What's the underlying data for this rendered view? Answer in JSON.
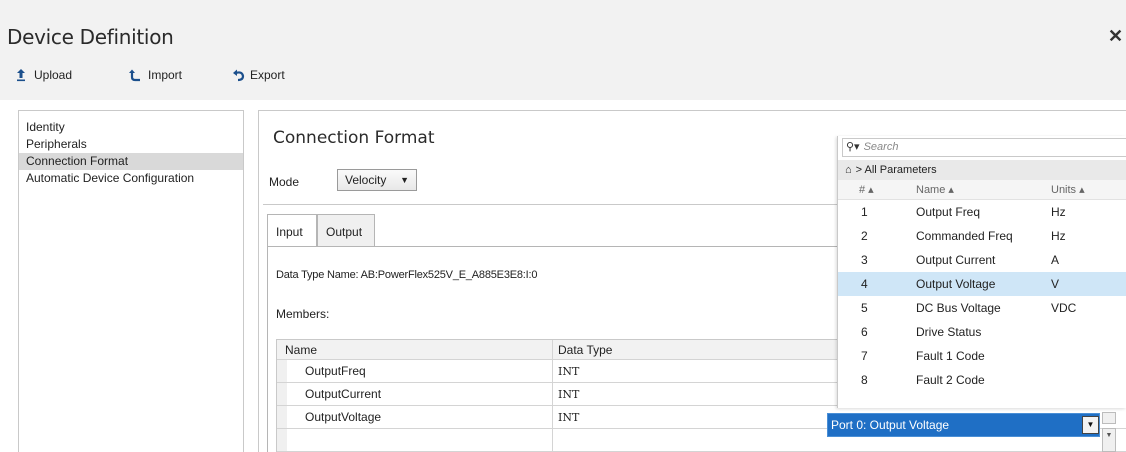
{
  "window": {
    "title": "Device Definition",
    "close_icon": "close-icon"
  },
  "toolbar": {
    "upload_label": "Upload",
    "import_label": "Import",
    "export_label": "Export"
  },
  "nav": {
    "items": [
      {
        "label": "Identity"
      },
      {
        "label": "Peripherals"
      },
      {
        "label": "Connection Format"
      },
      {
        "label": "Automatic Device Configuration"
      }
    ],
    "selected": "Connection Format"
  },
  "main": {
    "section_title": "Connection Format",
    "mode_label": "Mode",
    "mode_value": "Velocity",
    "tabs": [
      {
        "label": "Input"
      },
      {
        "label": "Output"
      }
    ],
    "data_type_name": "Data Type Name:   AB:PowerFlex525V_E_A885E3E8:I:0",
    "members_label": "Members:",
    "columns": {
      "name": "Name",
      "type": "Data Type"
    },
    "rows": [
      {
        "name": "OutputFreq",
        "type": "INT"
      },
      {
        "name": "OutputCurrent",
        "type": "INT"
      },
      {
        "name": "OutputVoltage",
        "type": "INT"
      }
    ]
  },
  "popup": {
    "search_placeholder": "Search",
    "breadcrumb": "> All Parameters",
    "headers": {
      "num": "# ▴",
      "name": "Name ▴",
      "units": "Units ▴"
    },
    "params": [
      {
        "num": "1",
        "name": "Output Freq",
        "units": "Hz"
      },
      {
        "num": "2",
        "name": "Commanded Freq",
        "units": "Hz"
      },
      {
        "num": "3",
        "name": "Output Current",
        "units": "A"
      },
      {
        "num": "4",
        "name": "Output Voltage",
        "units": "V"
      },
      {
        "num": "5",
        "name": "DC Bus Voltage",
        "units": "VDC"
      },
      {
        "num": "6",
        "name": "Drive Status",
        "units": ""
      },
      {
        "num": "7",
        "name": "Fault 1 Code",
        "units": ""
      },
      {
        "num": "8",
        "name": "Fault 2 Code",
        "units": ""
      }
    ],
    "selected_param": "Output Voltage"
  },
  "port_select": {
    "value": "Port 0: Output Voltage"
  },
  "colors": {
    "accent": "#1f6fc5",
    "selection": "#cfe6f7",
    "nav_selected": "#d9d9d9"
  }
}
